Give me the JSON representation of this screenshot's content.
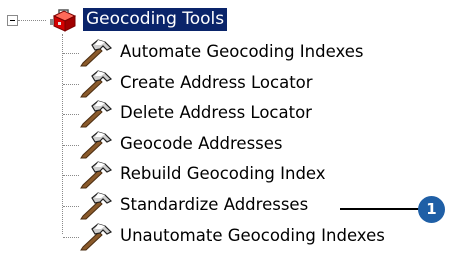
{
  "toolbox": {
    "root_label": "Geocoding Tools",
    "root_icon": "toolbox-icon",
    "expanded": true,
    "tools": [
      {
        "label": "Automate Geocoding Indexes",
        "icon": "hammer-icon"
      },
      {
        "label": "Create Address Locator",
        "icon": "hammer-icon"
      },
      {
        "label": "Delete Address Locator",
        "icon": "hammer-icon"
      },
      {
        "label": "Geocode Addresses",
        "icon": "hammer-icon"
      },
      {
        "label": "Rebuild Geocoding Index",
        "icon": "hammer-icon"
      },
      {
        "label": "Standardize Addresses",
        "icon": "hammer-icon"
      },
      {
        "label": "Unautomate Geocoding Indexes",
        "icon": "hammer-icon"
      }
    ]
  },
  "callout": {
    "number": "1",
    "color": "#1f5fa6"
  },
  "colors": {
    "selection": "#0a246a",
    "tree_lines": "#8a8a8a"
  }
}
